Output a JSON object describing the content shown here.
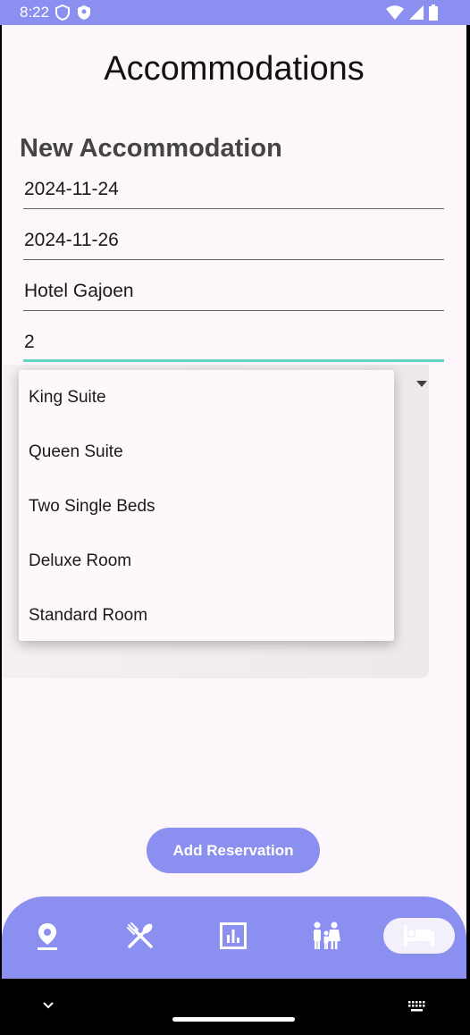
{
  "status_bar": {
    "time": "8:22"
  },
  "page": {
    "title": "Accommodations",
    "section_title": "New Accommodation"
  },
  "form": {
    "check_in": "2024-11-24",
    "check_out": "2024-11-26",
    "hotel_name": "Hotel Gajoen",
    "guests": "2"
  },
  "room_type_dropdown": {
    "options": [
      "King Suite",
      "Queen Suite",
      "Two Single Beds",
      "Deluxe Room",
      "Standard Room"
    ]
  },
  "actions": {
    "add_reservation": "Add Reservation"
  },
  "bottom_nav": {
    "items": [
      {
        "icon": "location-pin-icon"
      },
      {
        "icon": "restaurant-icon"
      },
      {
        "icon": "bar-chart-icon"
      },
      {
        "icon": "family-icon"
      },
      {
        "icon": "hotel-bed-icon",
        "active": true
      }
    ]
  },
  "colors": {
    "accent": "#8a8ff0",
    "background": "#fdf7fb",
    "focus_underline": "#66d4c0"
  }
}
